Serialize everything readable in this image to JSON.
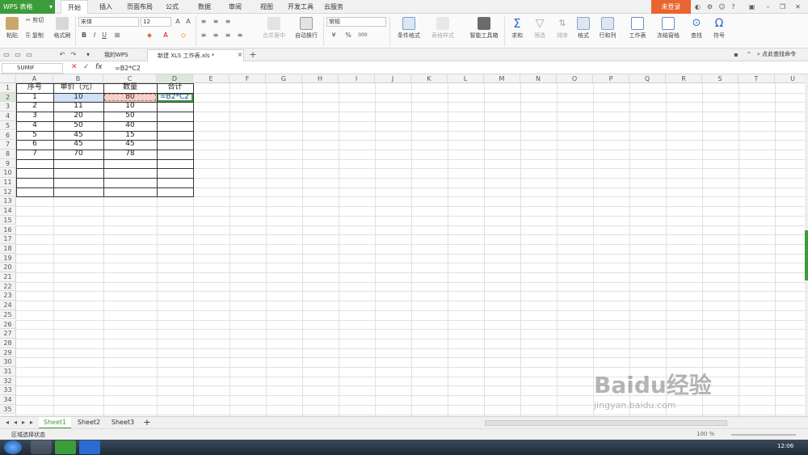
{
  "app": {
    "logo": "WPS 表格",
    "login": "未登录"
  },
  "menu_tabs": [
    "开始",
    "插入",
    "页面布局",
    "公式",
    "数据",
    "审阅",
    "视图",
    "开发工具",
    "云服务"
  ],
  "ribbon": {
    "paste": "粘贴",
    "cut": "剪切",
    "copy": "复制",
    "format_painter": "格式刷",
    "font": "宋体",
    "size": "12",
    "bold": "B",
    "italic": "I",
    "underline": "U",
    "merge": "合并居中",
    "wrap": "自动换行",
    "number_format": "常规",
    "conditional": "条件格式",
    "table_style": "表格样式",
    "smart_tools": "智能工具箱",
    "sum": "求和",
    "filter": "筛选",
    "sort": "排序",
    "format": "格式",
    "rowcol": "行和列",
    "worksheet": "工作表",
    "freeze": "冻结窗格",
    "find": "查找",
    "symbol": "符号",
    "percent": "%",
    "thousands": "000"
  },
  "doc_tabs": {
    "home": "我的WPS",
    "file": "新建 XLS 工作表.xls *",
    "search": "点此查找命令"
  },
  "formula_bar": {
    "name_box": "SUMIF",
    "cancel": "✕",
    "confirm": "✓",
    "fx": "fx",
    "formula": "=B2*C2"
  },
  "columns": [
    "A",
    "B",
    "C",
    "D",
    "E",
    "F",
    "G",
    "H",
    "I",
    "J",
    "K",
    "L",
    "M",
    "N",
    "O",
    "P",
    "Q",
    "R",
    "S",
    "T",
    "U"
  ],
  "rows": [
    "1",
    "2",
    "3",
    "4",
    "5",
    "6",
    "7",
    "8",
    "9",
    "10",
    "11",
    "12",
    "13",
    "14",
    "15",
    "16",
    "17",
    "18",
    "19",
    "20",
    "21",
    "22",
    "23",
    "24",
    "25",
    "26",
    "27",
    "28",
    "29",
    "30",
    "31",
    "32",
    "33",
    "34",
    "35",
    "36"
  ],
  "table": {
    "header": [
      "序号",
      "单价（元）",
      "数量",
      "合计"
    ],
    "rows": [
      [
        "1",
        "10",
        "80",
        "=B2*C2"
      ],
      [
        "2",
        "11",
        "10",
        ""
      ],
      [
        "3",
        "20",
        "50",
        ""
      ],
      [
        "4",
        "50",
        "40",
        ""
      ],
      [
        "5",
        "45",
        "15",
        ""
      ],
      [
        "6",
        "45",
        "45",
        ""
      ],
      [
        "7",
        "70",
        "78",
        ""
      ]
    ]
  },
  "sheet_tabs": [
    "Sheet1",
    "Sheet2",
    "Sheet3"
  ],
  "status": {
    "text": "区域选择状态",
    "zoom": "100 %"
  },
  "taskbar": {
    "clock": "12:06"
  },
  "watermark": "Baidu经验",
  "watermark_sub": "jingyan.baidu.com"
}
